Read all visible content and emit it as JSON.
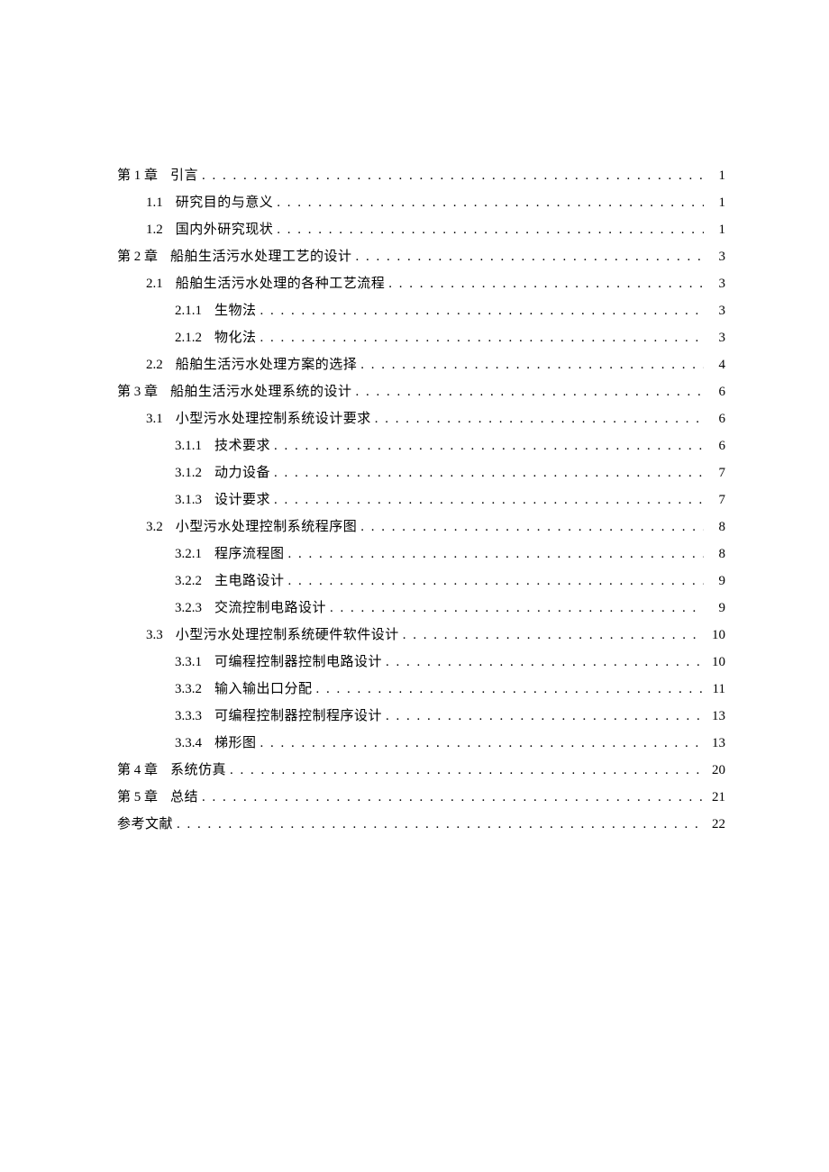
{
  "toc": [
    {
      "level": 0,
      "num": "第 1 章",
      "title": "引言",
      "page": "1"
    },
    {
      "level": 1,
      "num": "1.1",
      "title": "研究目的与意义",
      "page": "1"
    },
    {
      "level": 1,
      "num": "1.2",
      "title": "国内外研究现状",
      "page": "1"
    },
    {
      "level": 0,
      "num": "第 2 章",
      "title": "船舶生活污水处理工艺的设计",
      "page": "3"
    },
    {
      "level": 1,
      "num": "2.1",
      "title": "船舶生活污水处理的各种工艺流程",
      "page": "3"
    },
    {
      "level": 2,
      "num": "2.1.1",
      "title": "生物法",
      "page": "3"
    },
    {
      "level": 2,
      "num": "2.1.2",
      "title": "物化法",
      "page": "3"
    },
    {
      "level": 1,
      "num": "2.2",
      "title": "船舶生活污水处理方案的选择",
      "page": "4"
    },
    {
      "level": 0,
      "num": "第 3 章",
      "title": "船舶生活污水处理系统的设计",
      "page": "6"
    },
    {
      "level": 1,
      "num": "3.1",
      "title": "小型污水处理控制系统设计要求",
      "page": "6"
    },
    {
      "level": 2,
      "num": "3.1.1",
      "title": "技术要求",
      "page": "6"
    },
    {
      "level": 2,
      "num": "3.1.2",
      "title": "动力设备",
      "page": "7"
    },
    {
      "level": 2,
      "num": "3.1.3",
      "title": "设计要求",
      "page": "7"
    },
    {
      "level": 1,
      "num": "3.2",
      "title": "小型污水处理控制系统程序图",
      "page": "8"
    },
    {
      "level": 2,
      "num": "3.2.1",
      "title": "程序流程图",
      "page": "8"
    },
    {
      "level": 2,
      "num": "3.2.2",
      "title": "主电路设计",
      "page": "9"
    },
    {
      "level": 2,
      "num": "3.2.3",
      "title": "交流控制电路设计",
      "page": "9"
    },
    {
      "level": 1,
      "num": "3.3",
      "title": "小型污水处理控制系统硬件软件设计",
      "page": "10"
    },
    {
      "level": 2,
      "num": "3.3.1",
      "title": "可编程控制器控制电路设计",
      "page": "10"
    },
    {
      "level": 2,
      "num": "3.3.2",
      "title": "输入输出口分配",
      "page": "11"
    },
    {
      "level": 2,
      "num": "3.3.3",
      "title": "可编程控制器控制程序设计",
      "page": "13"
    },
    {
      "level": 2,
      "num": "3.3.4",
      "title": "梯形图",
      "page": "13"
    },
    {
      "level": 0,
      "num": "第 4 章",
      "title": "系统仿真",
      "page": "20"
    },
    {
      "level": 0,
      "num": "第 5 章",
      "title": "总结",
      "page": "21"
    },
    {
      "level": 0,
      "num": "",
      "title": "参考文献",
      "page": "22"
    }
  ]
}
